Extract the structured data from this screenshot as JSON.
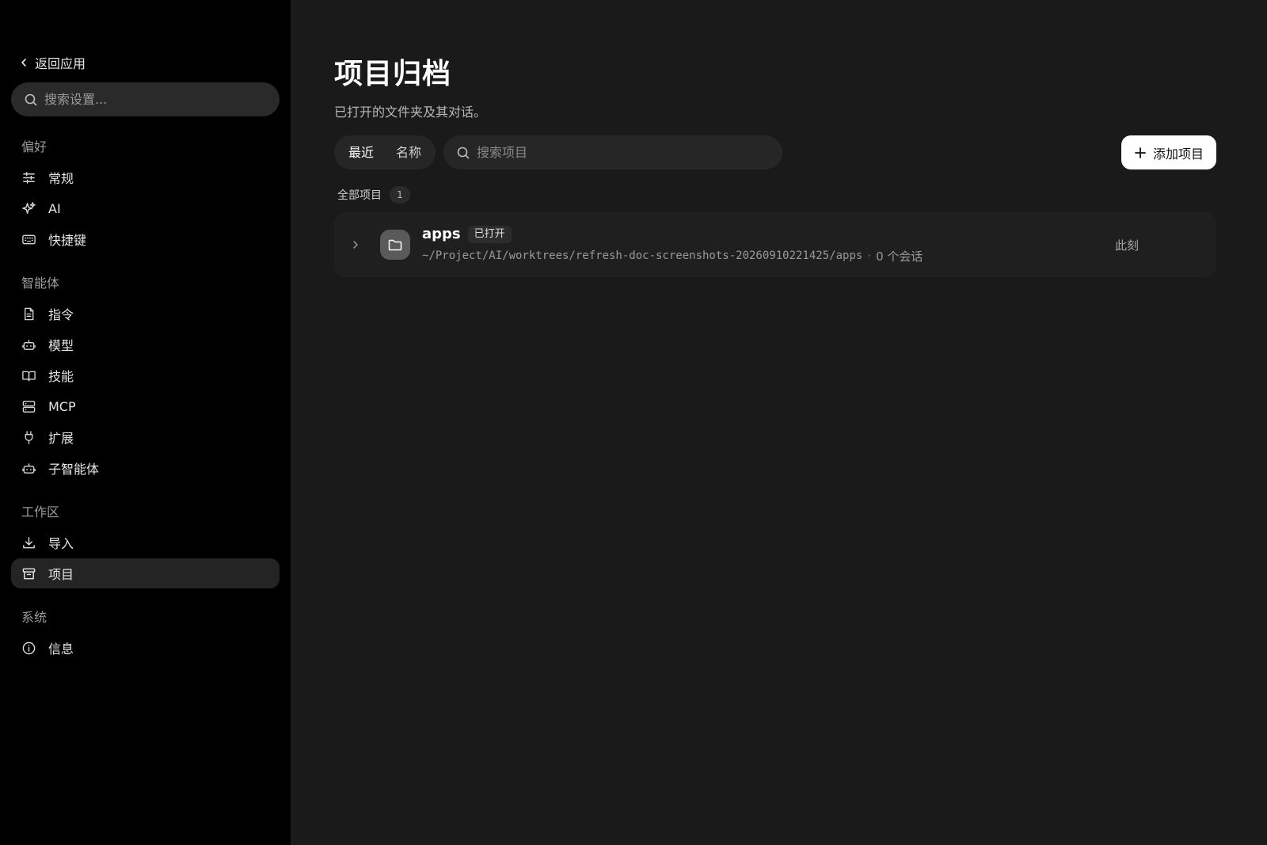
{
  "sidebar": {
    "back_label": "返回应用",
    "search_placeholder": "搜索设置...",
    "sections": [
      {
        "title": "偏好",
        "items": [
          {
            "label": "常规",
            "icon": "sliders-icon"
          },
          {
            "label": "AI",
            "icon": "sparkles-icon"
          },
          {
            "label": "快捷键",
            "icon": "keyboard-icon"
          }
        ]
      },
      {
        "title": "智能体",
        "items": [
          {
            "label": "指令",
            "icon": "file-text-icon"
          },
          {
            "label": "模型",
            "icon": "bot-icon"
          },
          {
            "label": "技能",
            "icon": "book-open-icon"
          },
          {
            "label": "MCP",
            "icon": "server-icon"
          },
          {
            "label": "扩展",
            "icon": "plug-icon"
          },
          {
            "label": "子智能体",
            "icon": "bot-icon"
          }
        ]
      },
      {
        "title": "工作区",
        "items": [
          {
            "label": "导入",
            "icon": "download-icon"
          },
          {
            "label": "项目",
            "icon": "archive-icon",
            "active": true
          }
        ]
      },
      {
        "title": "系统",
        "items": [
          {
            "label": "信息",
            "icon": "info-icon"
          }
        ]
      }
    ]
  },
  "main": {
    "title": "项目归档",
    "subtitle": "已打开的文件夹及其对话。",
    "sort_tabs": [
      {
        "label": "最近",
        "active": true
      },
      {
        "label": "名称",
        "active": false
      }
    ],
    "search_placeholder": "搜索项目",
    "add_button_label": "添加项目",
    "list_header": {
      "label": "全部项目",
      "count": "1"
    },
    "projects": [
      {
        "name": "apps",
        "badge": "已打开",
        "path": "~/Project/AI/worktrees/refresh-doc-screenshots-20260910221425/apps",
        "separator": "·",
        "sessions": "0 个会话",
        "time": "此刻"
      }
    ]
  },
  "colors": {
    "sidebar_bg": "#000000",
    "main_bg": "#1a1a1a",
    "active_item_bg": "#242424",
    "primary_button_bg": "#ffffff"
  }
}
